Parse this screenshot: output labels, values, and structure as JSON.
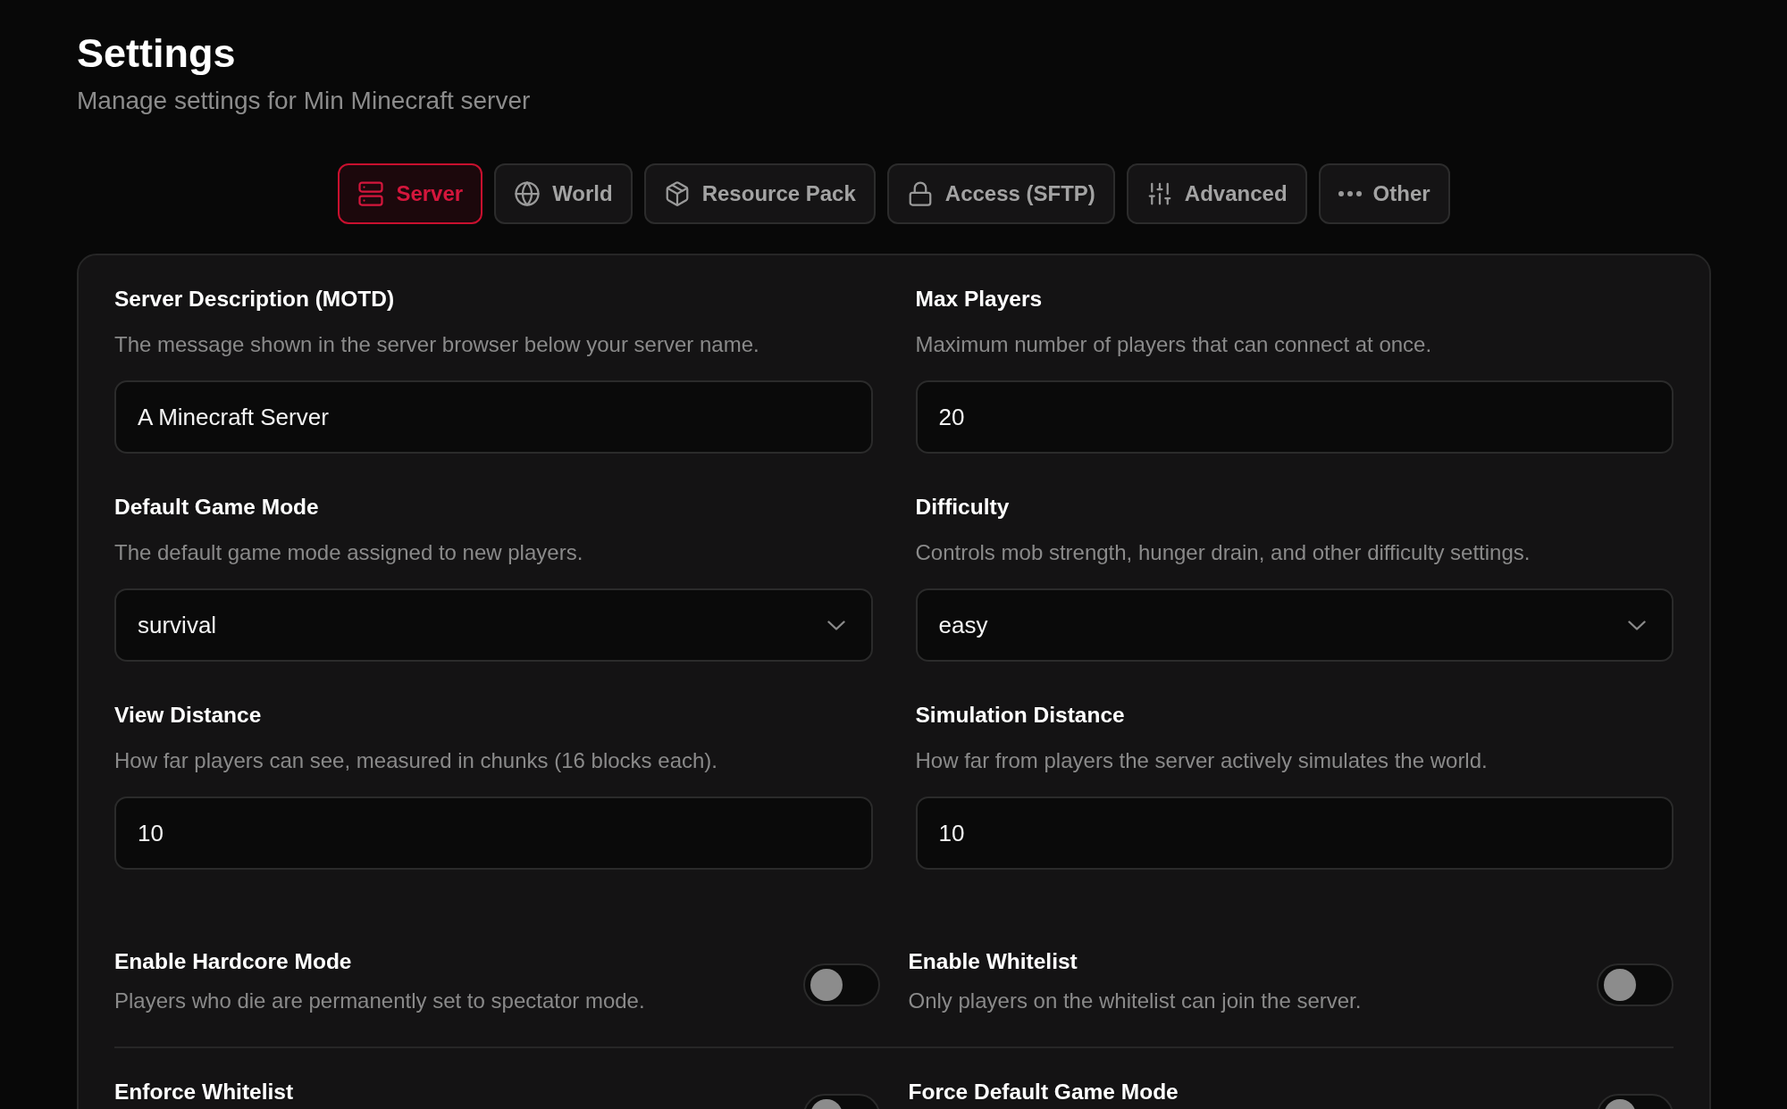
{
  "header": {
    "title": "Settings",
    "subtitle": "Manage settings for Min Minecraft server"
  },
  "tabs": [
    {
      "label": "Server",
      "selected": true
    },
    {
      "label": "World",
      "selected": false
    },
    {
      "label": "Resource Pack",
      "selected": false
    },
    {
      "label": "Access (SFTP)",
      "selected": false
    },
    {
      "label": "Advanced",
      "selected": false
    },
    {
      "label": "Other",
      "selected": false
    }
  ],
  "fields": [
    {
      "kind": "text",
      "label": "Server Description (MOTD)",
      "description": "The message shown in the server browser below your server name.",
      "value": "A Minecraft Server"
    },
    {
      "kind": "text",
      "label": "Max Players",
      "description": "Maximum number of players that can connect at once.",
      "value": "20"
    },
    {
      "kind": "select",
      "label": "Default Game Mode",
      "description": "The default game mode assigned to new players.",
      "value": "survival"
    },
    {
      "kind": "select",
      "label": "Difficulty",
      "description": "Controls mob strength, hunger drain, and other difficulty settings.",
      "value": "easy"
    },
    {
      "kind": "text",
      "label": "View Distance",
      "description": "How far players can see, measured in chunks (16 blocks each).",
      "value": "10"
    },
    {
      "kind": "text",
      "label": "Simulation Distance",
      "description": "How far from players the server actively simulates the world.",
      "value": "10"
    }
  ],
  "toggles": [
    {
      "label": "Enable Hardcore Mode",
      "description": "Players who die are permanently set to spectator mode.",
      "on": false
    },
    {
      "label": "Enable Whitelist",
      "description": "Only players on the whitelist can join the server.",
      "on": false
    },
    {
      "label": "Enforce Whitelist",
      "on": false
    },
    {
      "label": "Force Default Game Mode",
      "on": false
    }
  ]
}
